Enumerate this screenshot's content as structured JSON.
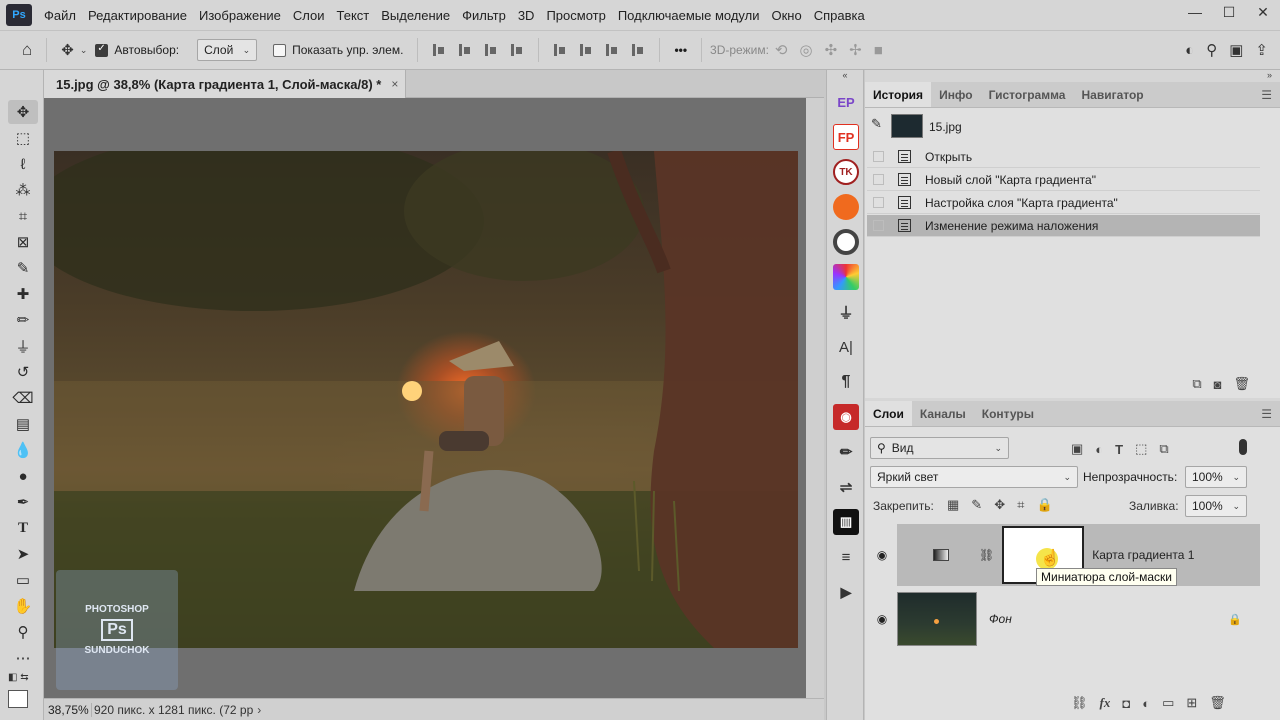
{
  "app": {
    "logo_text": "Ps",
    "menu": [
      "Файл",
      "Редактирование",
      "Изображение",
      "Слои",
      "Текст",
      "Выделение",
      "Фильтр",
      "3D",
      "Просмотр",
      "Подключаемые модули",
      "Окно",
      "Справка"
    ],
    "window_controls": [
      "—",
      "☐",
      "✕"
    ]
  },
  "options": {
    "autoselect_label": "Автовыбор:",
    "autoselect_value": "Слой",
    "show_controls_label": "Показать упр. элем.",
    "mode3d_label": "3D-режим:",
    "more": "•••"
  },
  "document": {
    "tab_title": "15.jpg @ 38,8% (Карта градиента 1, Слой-маска/8) *",
    "close": "×",
    "zoom": "38,75%",
    "status": "920 пикс. x 1281 пикс. (72 pp",
    "status_arrow": "›",
    "watermark_top": "PHOTOSHOP",
    "watermark_mid": "Ps",
    "watermark_bottom": "SUNDUCHOK"
  },
  "panel_strip": {
    "buttons": [
      "EP",
      "FP",
      "TK",
      "",
      "",
      "",
      "",
      "A|",
      "¶",
      "",
      "",
      "",
      "",
      "",
      "▶"
    ]
  },
  "history_panel": {
    "tabs": [
      "История",
      "Инфо",
      "Гистограмма",
      "Навигатор"
    ],
    "snapshot_name": "15.jpg",
    "items": [
      "Открыть",
      "Новый слой \"Карта градиента\"",
      "Настройка слоя \"Карта градиента\"",
      "Изменение режима наложения"
    ],
    "selected_index": 3
  },
  "layers_panel": {
    "tabs": [
      "Слои",
      "Каналы",
      "Контуры"
    ],
    "filter_value": "Вид",
    "blend_mode": "Яркий свет",
    "opacity_label": "Непрозрачность:",
    "opacity_value": "100%",
    "lock_label": "Закрепить:",
    "fill_label": "Заливка:",
    "fill_value": "100%",
    "layers": [
      {
        "name": "Карта градиента 1",
        "visible": true,
        "selected": true
      },
      {
        "name": "Фон",
        "visible": true,
        "selected": false,
        "locked": true
      }
    ],
    "tooltip": "Миниатюра слой-маски",
    "bottom_icons": [
      "link-icon",
      "fx-icon",
      "mask-icon",
      "adjustment-icon",
      "group-icon",
      "new-layer-icon",
      "trash-icon"
    ],
    "fx_label": "fx"
  },
  "colors": {
    "accent": "#31a8ff",
    "panel_bg": "#d6d6d6",
    "selected_row": "#b4b4b4",
    "canvas_bg": "#6f6f6f"
  }
}
